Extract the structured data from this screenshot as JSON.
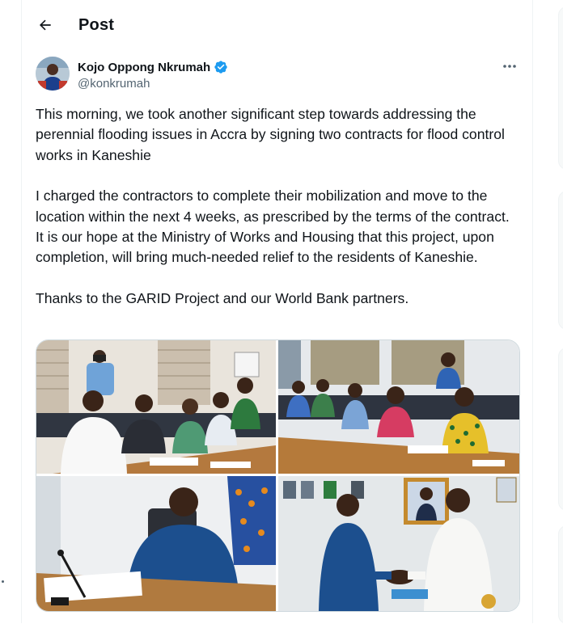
{
  "header": {
    "title": "Post",
    "back_icon": "arrow-left-icon"
  },
  "author": {
    "display_name": "Kojo Oppong Nkrumah",
    "handle": "@konkrumah",
    "verified_icon": "verified-badge-icon",
    "more_icon": "more-horizontal-icon"
  },
  "tweet": {
    "paragraphs": [
      "This morning, we took another significant step towards addressing the perennial flooding issues in Accra by signing two contracts for flood control works in Kaneshie",
      "I charged the contractors to complete their mobilization and move to the location within the next 4 weeks, as prescribed by the terms of the contract. It is our hope at the Ministry of Works and Housing that this project, upon completion, will bring much-needed relief to the residents of Kaneshie.",
      "Thanks to the GARID Project and our World Bank partners."
    ]
  },
  "colors": {
    "text": "#0f1419",
    "secondary": "#536471",
    "verified": "#1d9bf0",
    "border": "#cfd9de"
  }
}
